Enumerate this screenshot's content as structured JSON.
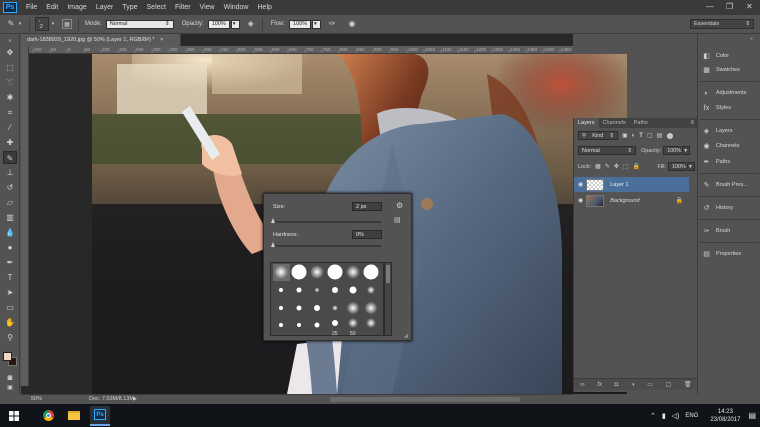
{
  "app": {
    "logo": "Ps"
  },
  "menu": [
    "File",
    "Edit",
    "Image",
    "Layer",
    "Type",
    "Select",
    "Filter",
    "View",
    "Window",
    "Help"
  ],
  "window_controls": {
    "minimize": "—",
    "maximize": "❐",
    "close": "✕"
  },
  "options": {
    "brush_size": "2",
    "mode_label": "Mode:",
    "mode_value": "Normal",
    "opacity_label": "Opacity:",
    "opacity_value": "100%",
    "flow_label": "Flow:",
    "flow_value": "100%",
    "workspace": "Essentials"
  },
  "document": {
    "tab_title": "dark-1838929_1920.jpg @ 50% (Layer 1, RGB/8#) *",
    "tab_close": "×",
    "zoom": "50%",
    "doc_info": "Doc: 7.03M/8.13M"
  },
  "ruler_ticks": [
    "100",
    "50",
    "0",
    "50",
    "100",
    "150",
    "200",
    "250",
    "300",
    "350",
    "400",
    "450",
    "500",
    "550",
    "600",
    "650",
    "700",
    "750",
    "800",
    "850",
    "900",
    "950",
    "1000",
    "1050",
    "1100",
    "1150",
    "1200",
    "1250",
    "1300",
    "1350",
    "1400",
    "1450"
  ],
  "brush_popup": {
    "size_label": "Size:",
    "size_value": "2 px",
    "hardness_label": "Hardness:",
    "hardness_value": "0%",
    "size_fraction": 0.0,
    "hardness_fraction": 0.0,
    "preset_numbers": [
      "25",
      "50"
    ]
  },
  "layers_panel": {
    "tabs": [
      "Layers",
      "Channels",
      "Paths"
    ],
    "kind_label": "Kind",
    "blend_mode": "Normal",
    "opacity_label": "Opacity:",
    "opacity_value": "100%",
    "lock_label": "Lock:",
    "fill_label": "Fill:",
    "fill_value": "100%",
    "layers": [
      {
        "name": "Layer 1",
        "selected": true
      },
      {
        "name": "Background",
        "selected": false
      }
    ]
  },
  "right_panels": [
    {
      "label": "Color",
      "icon": "color-icon"
    },
    {
      "label": "Swatches",
      "icon": "swatches-icon"
    },
    {
      "label": "Adjustments",
      "icon": "adjustments-icon"
    },
    {
      "label": "Styles",
      "icon": "styles-icon"
    },
    {
      "label": "Layers",
      "icon": "layers-icon"
    },
    {
      "label": "Channels",
      "icon": "channels-icon"
    },
    {
      "label": "Paths",
      "icon": "paths-icon"
    },
    {
      "label": "Brush Pres...",
      "icon": "brush-presets-icon"
    },
    {
      "label": "History",
      "icon": "history-icon"
    },
    {
      "label": "Brush",
      "icon": "brush-icon"
    },
    {
      "label": "Properties",
      "icon": "properties-icon"
    }
  ],
  "taskbar": {
    "language": "ENG",
    "time": "14:23",
    "date": "23/08/2017"
  },
  "colors": {
    "foreground": "#f2d7c2",
    "background": "#2a1510",
    "selection": "#4a6f9a"
  }
}
